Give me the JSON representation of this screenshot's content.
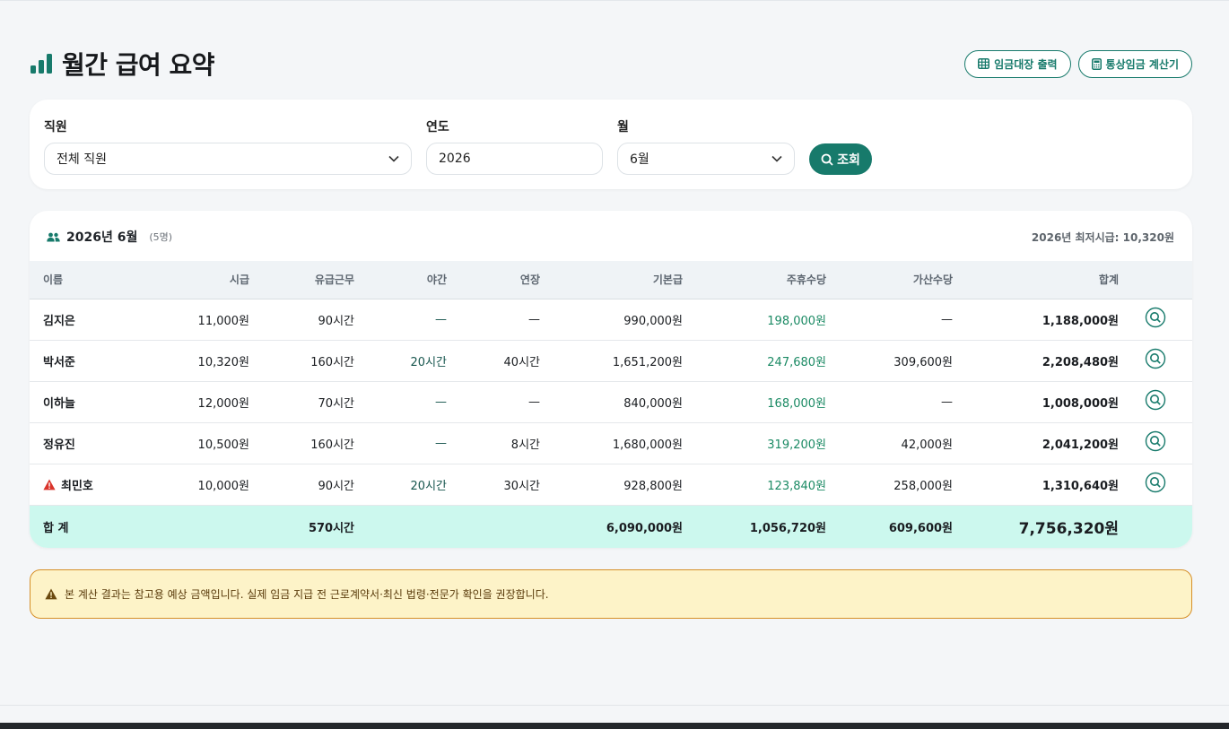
{
  "page": {
    "title": "월간 급여 요약",
    "actions": {
      "payroll_print": "임금대장 출력",
      "ordinary_wage_calc": "통상임금 계산기"
    }
  },
  "filters": {
    "employee_label": "직원",
    "employee_value": "전체 직원",
    "year_label": "연도",
    "year_value": "2026",
    "month_label": "월",
    "month_value": "6월",
    "search_label": "조회"
  },
  "summary": {
    "period": "2026년 6월",
    "count": "(5명)",
    "min_wage": "2026년 최저시급: 10,320원",
    "columns": [
      "이름",
      "시급",
      "유급근무",
      "야간",
      "연장",
      "기본급",
      "주휴수당",
      "가산수당",
      "합계"
    ],
    "rows": [
      {
        "name": "김지은",
        "wage": "11,000원",
        "paid": "90시간",
        "night": "—",
        "overtime": "—",
        "base": "990,000원",
        "weekly": "198,000원",
        "extra": "—",
        "total": "1,188,000원",
        "warning": false
      },
      {
        "name": "박서준",
        "wage": "10,320원",
        "paid": "160시간",
        "night": "20시간",
        "overtime": "40시간",
        "base": "1,651,200원",
        "weekly": "247,680원",
        "extra": "309,600원",
        "total": "2,208,480원",
        "warning": false
      },
      {
        "name": "이하늘",
        "wage": "12,000원",
        "paid": "70시간",
        "night": "—",
        "overtime": "—",
        "base": "840,000원",
        "weekly": "168,000원",
        "extra": "—",
        "total": "1,008,000원",
        "warning": false
      },
      {
        "name": "정유진",
        "wage": "10,500원",
        "paid": "160시간",
        "night": "—",
        "overtime": "8시간",
        "base": "1,680,000원",
        "weekly": "319,200원",
        "extra": "42,000원",
        "total": "2,041,200원",
        "warning": false
      },
      {
        "name": "최민호",
        "wage": "10,000원",
        "paid": "90시간",
        "night": "20시간",
        "overtime": "30시간",
        "base": "928,800원",
        "weekly": "123,840원",
        "extra": "258,000원",
        "total": "1,310,640원",
        "warning": true
      }
    ],
    "totals": {
      "label": "합 계",
      "paid": "570시간",
      "base": "6,090,000원",
      "weekly": "1,056,720원",
      "extra": "609,600원",
      "total": "7,756,320원"
    }
  },
  "notice": "본 계산 결과는 참고용 예상 금액입니다. 실제 임금 지급 전 근로계약서·최신 법령·전문가 확인을 권장합니다.",
  "colors": {
    "accent": "#177a6b",
    "positive": "#1b8a64",
    "total_row": "#ccf8ee",
    "notice_bg": "#fdf3c8",
    "notice_border": "#d68f27",
    "warning": "#d9342b"
  }
}
